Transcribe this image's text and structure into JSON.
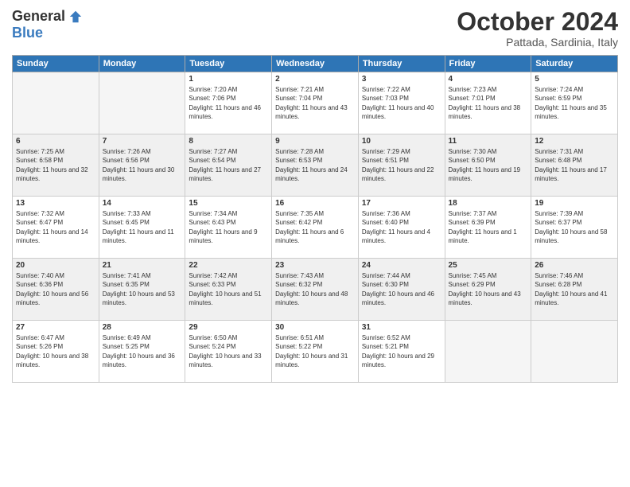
{
  "header": {
    "logo_general": "General",
    "logo_blue": "Blue",
    "month_title": "October 2024",
    "location": "Pattada, Sardinia, Italy"
  },
  "weekdays": [
    "Sunday",
    "Monday",
    "Tuesday",
    "Wednesday",
    "Thursday",
    "Friday",
    "Saturday"
  ],
  "weeks": [
    [
      {
        "day": "",
        "empty": true
      },
      {
        "day": "",
        "empty": true
      },
      {
        "day": "1",
        "sunrise": "Sunrise: 7:20 AM",
        "sunset": "Sunset: 7:06 PM",
        "daylight": "Daylight: 11 hours and 46 minutes."
      },
      {
        "day": "2",
        "sunrise": "Sunrise: 7:21 AM",
        "sunset": "Sunset: 7:04 PM",
        "daylight": "Daylight: 11 hours and 43 minutes."
      },
      {
        "day": "3",
        "sunrise": "Sunrise: 7:22 AM",
        "sunset": "Sunset: 7:03 PM",
        "daylight": "Daylight: 11 hours and 40 minutes."
      },
      {
        "day": "4",
        "sunrise": "Sunrise: 7:23 AM",
        "sunset": "Sunset: 7:01 PM",
        "daylight": "Daylight: 11 hours and 38 minutes."
      },
      {
        "day": "5",
        "sunrise": "Sunrise: 7:24 AM",
        "sunset": "Sunset: 6:59 PM",
        "daylight": "Daylight: 11 hours and 35 minutes."
      }
    ],
    [
      {
        "day": "6",
        "sunrise": "Sunrise: 7:25 AM",
        "sunset": "Sunset: 6:58 PM",
        "daylight": "Daylight: 11 hours and 32 minutes."
      },
      {
        "day": "7",
        "sunrise": "Sunrise: 7:26 AM",
        "sunset": "Sunset: 6:56 PM",
        "daylight": "Daylight: 11 hours and 30 minutes."
      },
      {
        "day": "8",
        "sunrise": "Sunrise: 7:27 AM",
        "sunset": "Sunset: 6:54 PM",
        "daylight": "Daylight: 11 hours and 27 minutes."
      },
      {
        "day": "9",
        "sunrise": "Sunrise: 7:28 AM",
        "sunset": "Sunset: 6:53 PM",
        "daylight": "Daylight: 11 hours and 24 minutes."
      },
      {
        "day": "10",
        "sunrise": "Sunrise: 7:29 AM",
        "sunset": "Sunset: 6:51 PM",
        "daylight": "Daylight: 11 hours and 22 minutes."
      },
      {
        "day": "11",
        "sunrise": "Sunrise: 7:30 AM",
        "sunset": "Sunset: 6:50 PM",
        "daylight": "Daylight: 11 hours and 19 minutes."
      },
      {
        "day": "12",
        "sunrise": "Sunrise: 7:31 AM",
        "sunset": "Sunset: 6:48 PM",
        "daylight": "Daylight: 11 hours and 17 minutes."
      }
    ],
    [
      {
        "day": "13",
        "sunrise": "Sunrise: 7:32 AM",
        "sunset": "Sunset: 6:47 PM",
        "daylight": "Daylight: 11 hours and 14 minutes."
      },
      {
        "day": "14",
        "sunrise": "Sunrise: 7:33 AM",
        "sunset": "Sunset: 6:45 PM",
        "daylight": "Daylight: 11 hours and 11 minutes."
      },
      {
        "day": "15",
        "sunrise": "Sunrise: 7:34 AM",
        "sunset": "Sunset: 6:43 PM",
        "daylight": "Daylight: 11 hours and 9 minutes."
      },
      {
        "day": "16",
        "sunrise": "Sunrise: 7:35 AM",
        "sunset": "Sunset: 6:42 PM",
        "daylight": "Daylight: 11 hours and 6 minutes."
      },
      {
        "day": "17",
        "sunrise": "Sunrise: 7:36 AM",
        "sunset": "Sunset: 6:40 PM",
        "daylight": "Daylight: 11 hours and 4 minutes."
      },
      {
        "day": "18",
        "sunrise": "Sunrise: 7:37 AM",
        "sunset": "Sunset: 6:39 PM",
        "daylight": "Daylight: 11 hours and 1 minute."
      },
      {
        "day": "19",
        "sunrise": "Sunrise: 7:39 AM",
        "sunset": "Sunset: 6:37 PM",
        "daylight": "Daylight: 10 hours and 58 minutes."
      }
    ],
    [
      {
        "day": "20",
        "sunrise": "Sunrise: 7:40 AM",
        "sunset": "Sunset: 6:36 PM",
        "daylight": "Daylight: 10 hours and 56 minutes."
      },
      {
        "day": "21",
        "sunrise": "Sunrise: 7:41 AM",
        "sunset": "Sunset: 6:35 PM",
        "daylight": "Daylight: 10 hours and 53 minutes."
      },
      {
        "day": "22",
        "sunrise": "Sunrise: 7:42 AM",
        "sunset": "Sunset: 6:33 PM",
        "daylight": "Daylight: 10 hours and 51 minutes."
      },
      {
        "day": "23",
        "sunrise": "Sunrise: 7:43 AM",
        "sunset": "Sunset: 6:32 PM",
        "daylight": "Daylight: 10 hours and 48 minutes."
      },
      {
        "day": "24",
        "sunrise": "Sunrise: 7:44 AM",
        "sunset": "Sunset: 6:30 PM",
        "daylight": "Daylight: 10 hours and 46 minutes."
      },
      {
        "day": "25",
        "sunrise": "Sunrise: 7:45 AM",
        "sunset": "Sunset: 6:29 PM",
        "daylight": "Daylight: 10 hours and 43 minutes."
      },
      {
        "day": "26",
        "sunrise": "Sunrise: 7:46 AM",
        "sunset": "Sunset: 6:28 PM",
        "daylight": "Daylight: 10 hours and 41 minutes."
      }
    ],
    [
      {
        "day": "27",
        "sunrise": "Sunrise: 6:47 AM",
        "sunset": "Sunset: 5:26 PM",
        "daylight": "Daylight: 10 hours and 38 minutes."
      },
      {
        "day": "28",
        "sunrise": "Sunrise: 6:49 AM",
        "sunset": "Sunset: 5:25 PM",
        "daylight": "Daylight: 10 hours and 36 minutes."
      },
      {
        "day": "29",
        "sunrise": "Sunrise: 6:50 AM",
        "sunset": "Sunset: 5:24 PM",
        "daylight": "Daylight: 10 hours and 33 minutes."
      },
      {
        "day": "30",
        "sunrise": "Sunrise: 6:51 AM",
        "sunset": "Sunset: 5:22 PM",
        "daylight": "Daylight: 10 hours and 31 minutes."
      },
      {
        "day": "31",
        "sunrise": "Sunrise: 6:52 AM",
        "sunset": "Sunset: 5:21 PM",
        "daylight": "Daylight: 10 hours and 29 minutes."
      },
      {
        "day": "",
        "empty": true
      },
      {
        "day": "",
        "empty": true
      }
    ]
  ]
}
